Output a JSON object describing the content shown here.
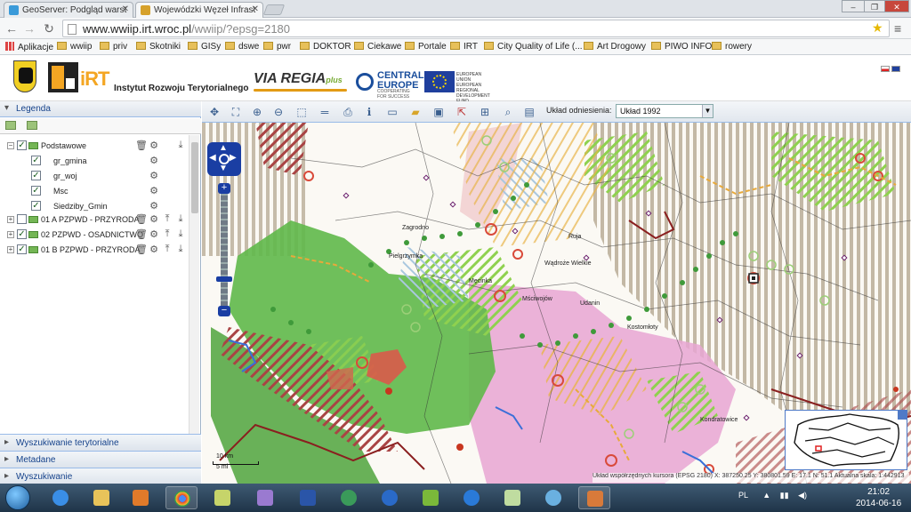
{
  "browser": {
    "tabs": [
      {
        "label": "GeoServer: Podgląd warst",
        "active": false
      },
      {
        "label": "Wojewódzki Węzeł Infrast",
        "active": true
      }
    ],
    "url_host": "www.wwiip.irt.wroc.pl",
    "url_path": "/wwiip/?epsg=2180",
    "bookmarks": [
      "Aplikacje",
      "wwiip",
      "priv",
      "Skotniki",
      "GISy",
      "dswe",
      "pwr",
      "DOKTOR",
      "Ciekawe",
      "Portale",
      "IRT",
      "City Quality of Life (...",
      "Art Drogowy",
      "PIWO INFO",
      "rowery"
    ]
  },
  "header": {
    "org_logo": "iRT",
    "org_name": "Instytut Rozwoju Terytorialnego",
    "via_regia": "VIA REGIA",
    "via_regia_plus": "plus",
    "central_europe_1": "CENTRAL",
    "central_europe_2": "EUROPE",
    "central_europe_sub": "COOPERATING FOR SUCCESS",
    "eu_text": "EUROPEAN UNION EUROPEAN REGIONAL DEVELOPMENT FUND"
  },
  "legend": {
    "title": "Legenda",
    "layers": [
      {
        "label": "Podstawowe",
        "checked": true,
        "group": true,
        "expanded": true
      },
      {
        "label": "gr_gmina",
        "checked": true,
        "group": false
      },
      {
        "label": "gr_woj",
        "checked": true,
        "group": false
      },
      {
        "label": "Msc",
        "checked": true,
        "group": false
      },
      {
        "label": "Siedziby_Gmin",
        "checked": true,
        "group": false
      },
      {
        "label": "01 A PZPWD - PRZYRODA",
        "checked": false,
        "group": true,
        "expanded": false
      },
      {
        "label": "02 PZPWD - OSADNICTWO",
        "checked": true,
        "group": true,
        "expanded": false
      },
      {
        "label": "01 B PZPWD - PRZYRODA",
        "checked": true,
        "group": true,
        "expanded": false
      }
    ]
  },
  "accordions": [
    "Wyszukiwanie terytorialne",
    "Metadane",
    "Wyszukiwanie"
  ],
  "toolbar": {
    "crs_label": "Układ odniesienia:",
    "crs_value": "Układ 1992"
  },
  "map": {
    "place_names": [
      "Zagrodno",
      "Pielgrzymka",
      "Męcinka",
      "Wądroże Wielkie",
      "Mściwojów",
      "Udanin",
      "Kostomłoty",
      "Kondratowice",
      "Ruja"
    ],
    "scale_km": "10 km",
    "scale_mi": "5 mi",
    "coords_text": "Układ współrzędnych kursora (EPSG 2180) X: 387250.25 Y: 380801.59 E: 17.1 N: 51.1 Aktualna skala: 1:442913"
  },
  "taskbar": {
    "lang": "PL",
    "time": "21:02",
    "date": "2014-06-16"
  }
}
